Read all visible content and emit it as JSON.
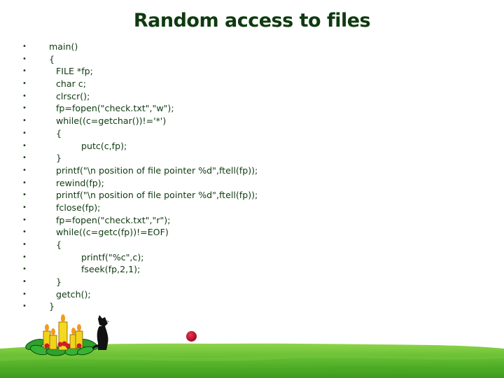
{
  "slide": {
    "title": "Random access to files",
    "bullet_glyph": "•",
    "code_lines": [
      {
        "text": "main()",
        "indent": 0
      },
      {
        "text": "{",
        "indent": 0
      },
      {
        "text": "FILE *fp;",
        "indent": 1
      },
      {
        "text": "char c;",
        "indent": 1
      },
      {
        "text": "clrscr();",
        "indent": 1
      },
      {
        "text": "fp=fopen(\"check.txt\",\"w\");",
        "indent": 1
      },
      {
        "text": "while((c=getchar())!='*')",
        "indent": 1
      },
      {
        "text": "{",
        "indent": 1
      },
      {
        "text": "putc(c,fp);",
        "indent": 2
      },
      {
        "text": "}",
        "indent": 1
      },
      {
        "text": "printf(\"\\n position of file pointer %d\",ftell(fp));",
        "indent": 1
      },
      {
        "text": "rewind(fp);",
        "indent": 1
      },
      {
        "text": "printf(\"\\n position of file pointer %d\",ftell(fp));",
        "indent": 1
      },
      {
        "text": "fclose(fp);",
        "indent": 1
      },
      {
        "text": "fp=fopen(\"check.txt\",\"r\");",
        "indent": 1
      },
      {
        "text": "while((c=getc(fp))!=EOF)",
        "indent": 1
      },
      {
        "text": "{",
        "indent": 1
      },
      {
        "text": "printf(\"%c\",c);",
        "indent": 2
      },
      {
        "text": "fseek(fp,2,1);",
        "indent": 2
      },
      {
        "text": "}",
        "indent": 1
      },
      {
        "text": "getch();",
        "indent": 1
      },
      {
        "text": "}",
        "indent": 0
      }
    ],
    "decorations": {
      "candles": "advent-candle-wreath-clipart",
      "cat": "black-cat-clipart",
      "ball": "red-ball",
      "background": "green-grass-hill"
    },
    "colors": {
      "text": "#0f3a10",
      "grass": "#5cb82e",
      "ball": "#b5112c"
    }
  }
}
